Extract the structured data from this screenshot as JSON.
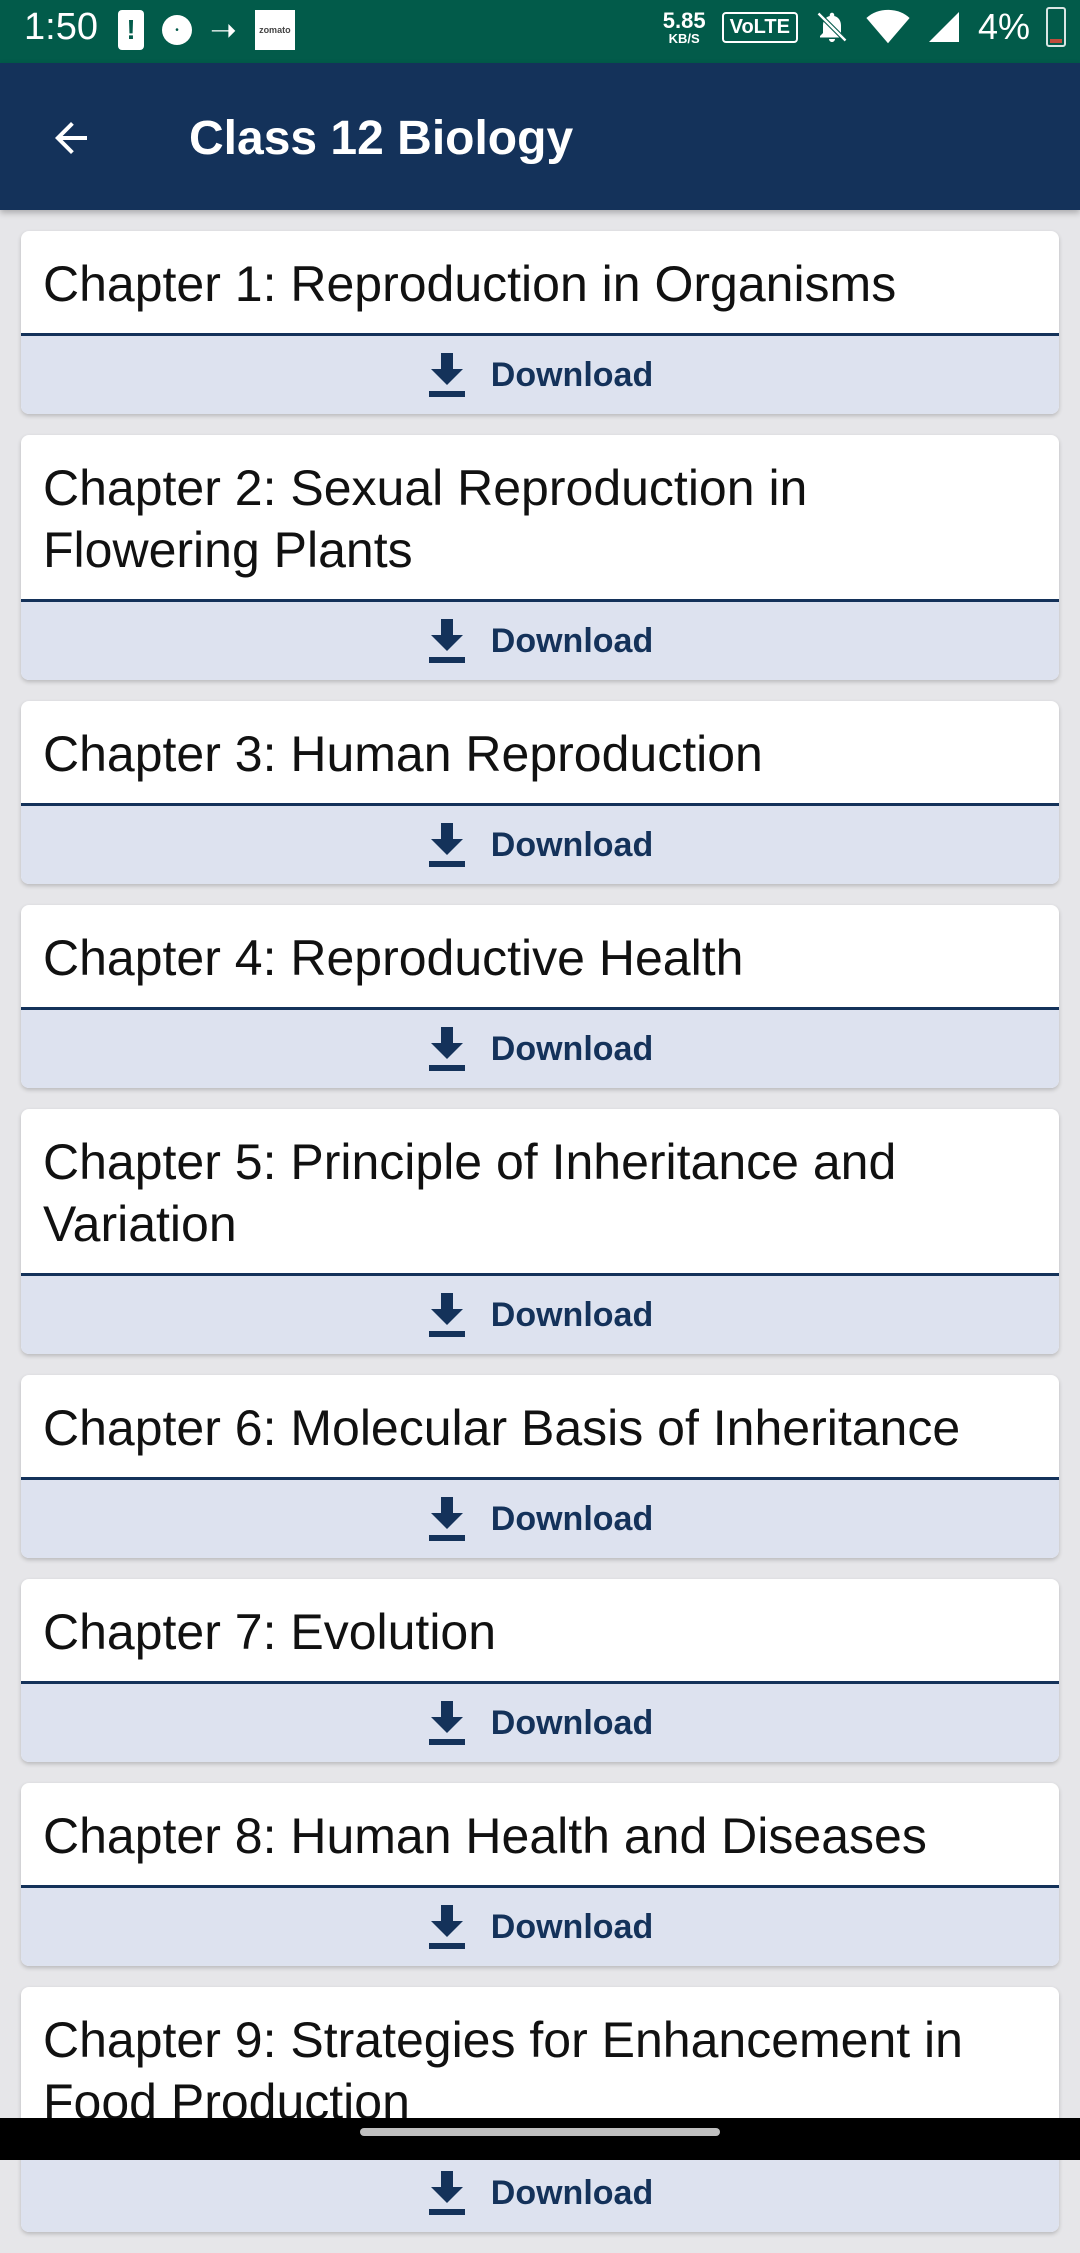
{
  "status_bar": {
    "time": "1:50",
    "zomato_label": "zomato",
    "speed_value": "5.85",
    "speed_unit": "KB/S",
    "volte": "VoLTE",
    "battery_percent": "4%",
    "background_color": "#025b4a"
  },
  "app_bar": {
    "title": "Class 12 Biology",
    "background_color": "#14325a"
  },
  "chapters": [
    {
      "title": "Chapter 1: Reproduction in Organisms",
      "action": "Download"
    },
    {
      "title": "Chapter 2: Sexual Reproduction in Flowering Plants",
      "action": "Download"
    },
    {
      "title": "Chapter 3: Human Reproduction",
      "action": "Download"
    },
    {
      "title": "Chapter 4: Reproductive Health",
      "action": "Download"
    },
    {
      "title": "Chapter 5: Principle of Inheritance and Variation",
      "action": "Download"
    },
    {
      "title": "Chapter 6: Molecular Basis of Inheritance",
      "action": "Download"
    },
    {
      "title": "Chapter 7: Evolution",
      "action": "Download"
    },
    {
      "title": "Chapter 8: Human Health and Diseases",
      "action": "Download"
    },
    {
      "title": "Chapter 9: Strategies for Enhancement in Food Production",
      "action": "Download"
    }
  ],
  "colors": {
    "accent": "#14325a",
    "action_background": "#dde2ef",
    "page_background": "#e6e6e9"
  }
}
